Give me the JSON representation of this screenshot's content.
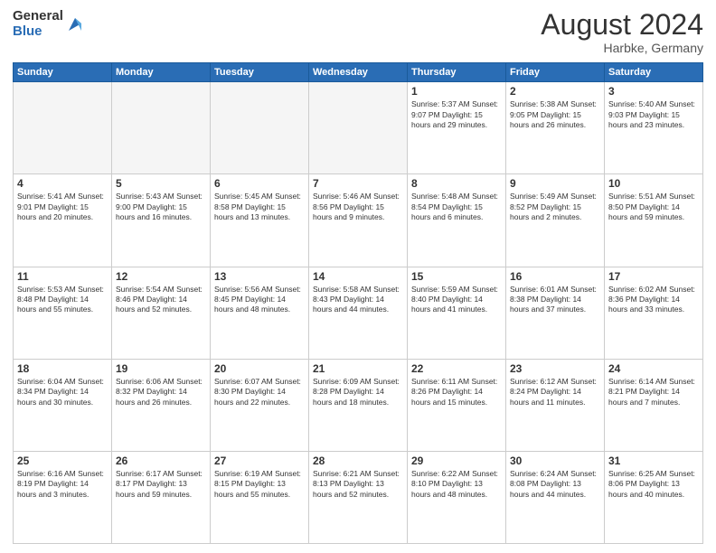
{
  "header": {
    "logo_general": "General",
    "logo_blue": "Blue",
    "month_title": "August 2024",
    "location": "Harbke, Germany"
  },
  "days_of_week": [
    "Sunday",
    "Monday",
    "Tuesday",
    "Wednesday",
    "Thursday",
    "Friday",
    "Saturday"
  ],
  "weeks": [
    [
      {
        "day": "",
        "info": ""
      },
      {
        "day": "",
        "info": ""
      },
      {
        "day": "",
        "info": ""
      },
      {
        "day": "",
        "info": ""
      },
      {
        "day": "1",
        "info": "Sunrise: 5:37 AM\nSunset: 9:07 PM\nDaylight: 15 hours\nand 29 minutes."
      },
      {
        "day": "2",
        "info": "Sunrise: 5:38 AM\nSunset: 9:05 PM\nDaylight: 15 hours\nand 26 minutes."
      },
      {
        "day": "3",
        "info": "Sunrise: 5:40 AM\nSunset: 9:03 PM\nDaylight: 15 hours\nand 23 minutes."
      }
    ],
    [
      {
        "day": "4",
        "info": "Sunrise: 5:41 AM\nSunset: 9:01 PM\nDaylight: 15 hours\nand 20 minutes."
      },
      {
        "day": "5",
        "info": "Sunrise: 5:43 AM\nSunset: 9:00 PM\nDaylight: 15 hours\nand 16 minutes."
      },
      {
        "day": "6",
        "info": "Sunrise: 5:45 AM\nSunset: 8:58 PM\nDaylight: 15 hours\nand 13 minutes."
      },
      {
        "day": "7",
        "info": "Sunrise: 5:46 AM\nSunset: 8:56 PM\nDaylight: 15 hours\nand 9 minutes."
      },
      {
        "day": "8",
        "info": "Sunrise: 5:48 AM\nSunset: 8:54 PM\nDaylight: 15 hours\nand 6 minutes."
      },
      {
        "day": "9",
        "info": "Sunrise: 5:49 AM\nSunset: 8:52 PM\nDaylight: 15 hours\nand 2 minutes."
      },
      {
        "day": "10",
        "info": "Sunrise: 5:51 AM\nSunset: 8:50 PM\nDaylight: 14 hours\nand 59 minutes."
      }
    ],
    [
      {
        "day": "11",
        "info": "Sunrise: 5:53 AM\nSunset: 8:48 PM\nDaylight: 14 hours\nand 55 minutes."
      },
      {
        "day": "12",
        "info": "Sunrise: 5:54 AM\nSunset: 8:46 PM\nDaylight: 14 hours\nand 52 minutes."
      },
      {
        "day": "13",
        "info": "Sunrise: 5:56 AM\nSunset: 8:45 PM\nDaylight: 14 hours\nand 48 minutes."
      },
      {
        "day": "14",
        "info": "Sunrise: 5:58 AM\nSunset: 8:43 PM\nDaylight: 14 hours\nand 44 minutes."
      },
      {
        "day": "15",
        "info": "Sunrise: 5:59 AM\nSunset: 8:40 PM\nDaylight: 14 hours\nand 41 minutes."
      },
      {
        "day": "16",
        "info": "Sunrise: 6:01 AM\nSunset: 8:38 PM\nDaylight: 14 hours\nand 37 minutes."
      },
      {
        "day": "17",
        "info": "Sunrise: 6:02 AM\nSunset: 8:36 PM\nDaylight: 14 hours\nand 33 minutes."
      }
    ],
    [
      {
        "day": "18",
        "info": "Sunrise: 6:04 AM\nSunset: 8:34 PM\nDaylight: 14 hours\nand 30 minutes."
      },
      {
        "day": "19",
        "info": "Sunrise: 6:06 AM\nSunset: 8:32 PM\nDaylight: 14 hours\nand 26 minutes."
      },
      {
        "day": "20",
        "info": "Sunrise: 6:07 AM\nSunset: 8:30 PM\nDaylight: 14 hours\nand 22 minutes."
      },
      {
        "day": "21",
        "info": "Sunrise: 6:09 AM\nSunset: 8:28 PM\nDaylight: 14 hours\nand 18 minutes."
      },
      {
        "day": "22",
        "info": "Sunrise: 6:11 AM\nSunset: 8:26 PM\nDaylight: 14 hours\nand 15 minutes."
      },
      {
        "day": "23",
        "info": "Sunrise: 6:12 AM\nSunset: 8:24 PM\nDaylight: 14 hours\nand 11 minutes."
      },
      {
        "day": "24",
        "info": "Sunrise: 6:14 AM\nSunset: 8:21 PM\nDaylight: 14 hours\nand 7 minutes."
      }
    ],
    [
      {
        "day": "25",
        "info": "Sunrise: 6:16 AM\nSunset: 8:19 PM\nDaylight: 14 hours\nand 3 minutes."
      },
      {
        "day": "26",
        "info": "Sunrise: 6:17 AM\nSunset: 8:17 PM\nDaylight: 13 hours\nand 59 minutes."
      },
      {
        "day": "27",
        "info": "Sunrise: 6:19 AM\nSunset: 8:15 PM\nDaylight: 13 hours\nand 55 minutes."
      },
      {
        "day": "28",
        "info": "Sunrise: 6:21 AM\nSunset: 8:13 PM\nDaylight: 13 hours\nand 52 minutes."
      },
      {
        "day": "29",
        "info": "Sunrise: 6:22 AM\nSunset: 8:10 PM\nDaylight: 13 hours\nand 48 minutes."
      },
      {
        "day": "30",
        "info": "Sunrise: 6:24 AM\nSunset: 8:08 PM\nDaylight: 13 hours\nand 44 minutes."
      },
      {
        "day": "31",
        "info": "Sunrise: 6:25 AM\nSunset: 8:06 PM\nDaylight: 13 hours\nand 40 minutes."
      }
    ]
  ]
}
